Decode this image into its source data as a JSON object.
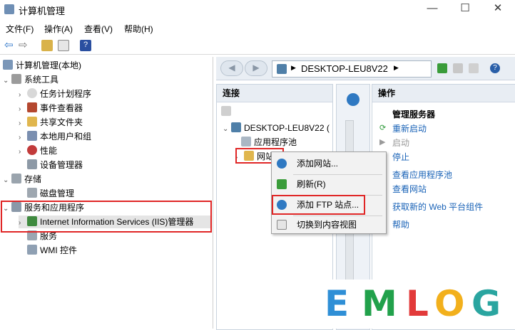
{
  "window": {
    "title": "计算机管理",
    "controls": [
      "—",
      "☐",
      "✕"
    ]
  },
  "menu": [
    "文件(F)",
    "操作(A)",
    "查看(V)",
    "帮助(H)"
  ],
  "tree": {
    "root": "计算机管理(本地)",
    "system_tools": "系统工具",
    "system_items": [
      "任务计划程序",
      "事件查看器",
      "共享文件夹",
      "本地用户和组",
      "性能",
      "设备管理器"
    ],
    "storage": "存储",
    "storage_items": [
      "磁盘管理"
    ],
    "services_apps": "服务和应用程序",
    "services_items": [
      "Internet Information Services (IIS)管理器",
      "服务",
      "WMI 控件"
    ]
  },
  "iis": {
    "address": "DESKTOP-LEU8V22",
    "connections_title": "连接",
    "server_node": "DESKTOP-LEU8V22 (",
    "app_pools": "应用程序池",
    "sites": "网站",
    "actions_title": "操作",
    "manage_server": "管理服务器",
    "actions": [
      {
        "label": "重新启动",
        "enabled": true,
        "icon": "restart-icon"
      },
      {
        "label": "启动",
        "enabled": false,
        "icon": "start-icon"
      },
      {
        "label": "停止",
        "enabled": true,
        "icon": "stop-icon"
      },
      {
        "label": "查看应用程序池",
        "enabled": true,
        "icon": ""
      },
      {
        "label": "查看网站",
        "enabled": true,
        "icon": ""
      },
      {
        "label": "获取新的 Web 平台组件",
        "enabled": true,
        "icon": ""
      },
      {
        "label": "帮助",
        "enabled": true,
        "icon": "help-icon"
      }
    ]
  },
  "context_menu": [
    "添加网站...",
    "刷新(R)",
    "添加 FTP 站点...",
    "切换到内容视图"
  ],
  "watermark": {
    "letters": [
      "E",
      "M",
      "L",
      "O",
      "G"
    ],
    "colors": [
      "#2f8fd6",
      "#21a14b",
      "#e23a3a",
      "#f2b01c",
      "#2aa5a0"
    ]
  },
  "colors": {
    "highlight_box": "#e02626",
    "link": "#1a63b7"
  }
}
